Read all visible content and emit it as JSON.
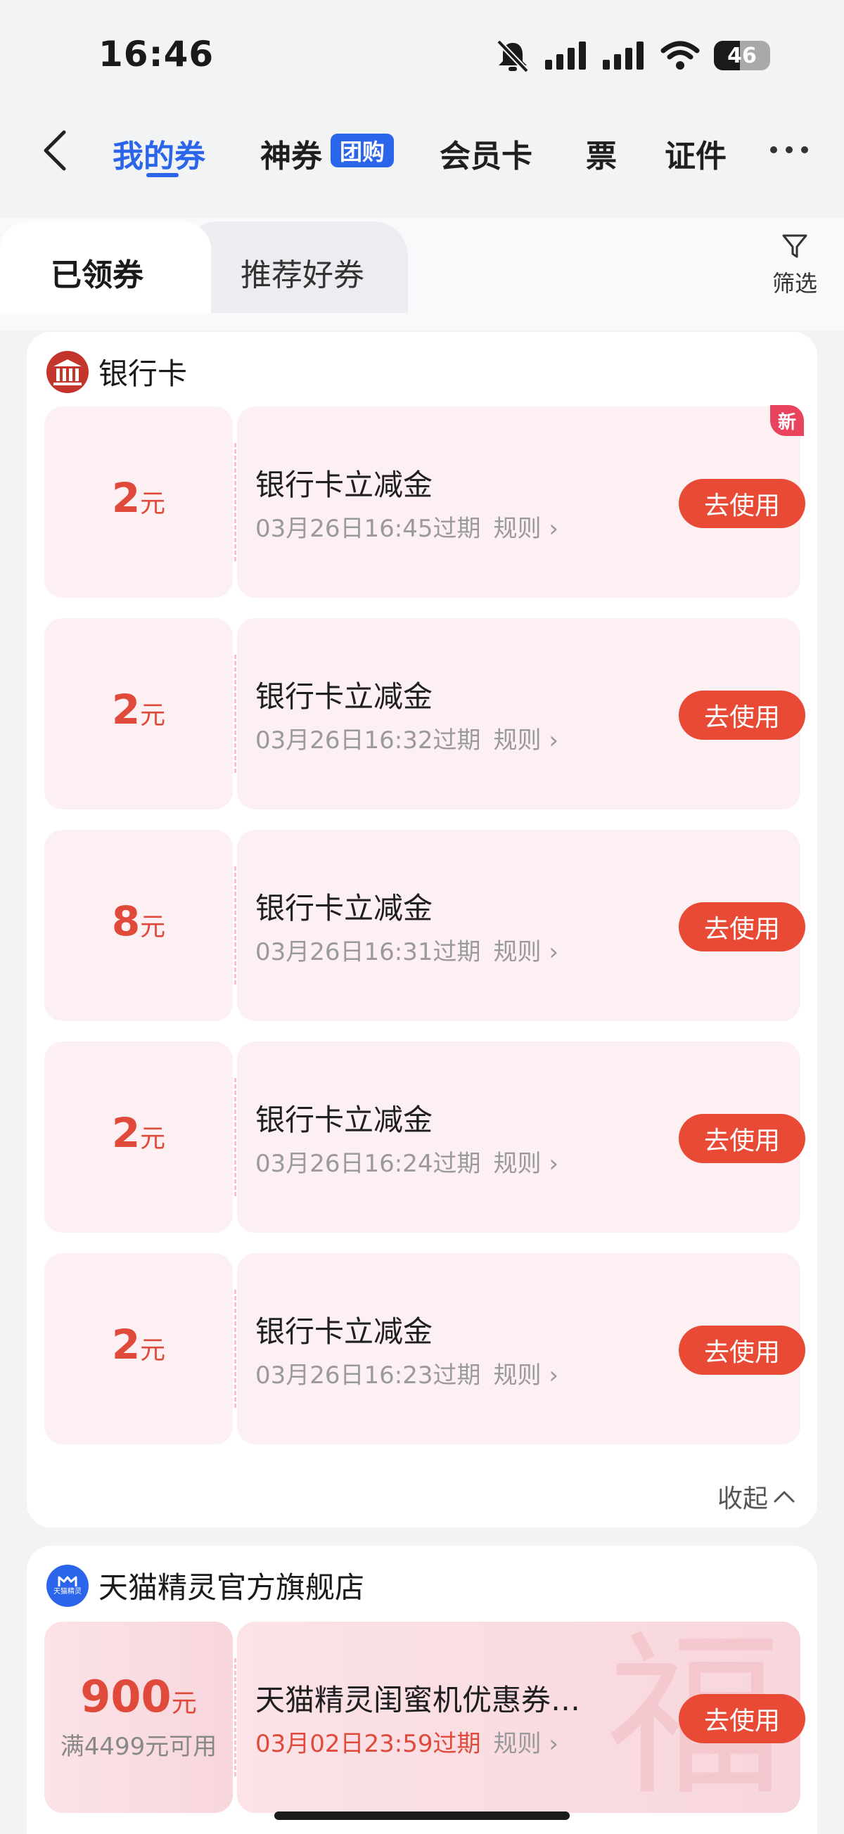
{
  "status_bar": {
    "time": "16:46",
    "battery_level": "46"
  },
  "nav": {
    "tabs": [
      {
        "label": "我的券"
      },
      {
        "label": "神券"
      },
      {
        "label": "会员卡"
      },
      {
        "label": "票"
      },
      {
        "label": "证件"
      }
    ],
    "tuan_badge": "团购"
  },
  "subtabs": {
    "received": "已领券",
    "recommended": "推荐好券",
    "filter": "筛选"
  },
  "bank_section": {
    "title": "银行卡",
    "collapse_label": "收起",
    "new_badge": "新",
    "coupons": [
      {
        "amount": "2",
        "unit": "元",
        "name": "银行卡立减金",
        "expiry": "03月26日16:45过期",
        "rule": "规则",
        "button": "去使用"
      },
      {
        "amount": "2",
        "unit": "元",
        "name": "银行卡立减金",
        "expiry": "03月26日16:32过期",
        "rule": "规则",
        "button": "去使用"
      },
      {
        "amount": "8",
        "unit": "元",
        "name": "银行卡立减金",
        "expiry": "03月26日16:31过期",
        "rule": "规则",
        "button": "去使用"
      },
      {
        "amount": "2",
        "unit": "元",
        "name": "银行卡立减金",
        "expiry": "03月26日16:24过期",
        "rule": "规则",
        "button": "去使用"
      },
      {
        "amount": "2",
        "unit": "元",
        "name": "银行卡立减金",
        "expiry": "03月26日16:23过期",
        "rule": "规则",
        "button": "去使用"
      }
    ]
  },
  "tmall_section": {
    "title": "天猫精灵官方旗舰店",
    "logo_text": "天猫精灵",
    "coupon": {
      "amount": "900",
      "unit": "元",
      "min": "满4499元可用",
      "name": "天猫精灵闺蜜机优惠券…",
      "expiry": "03月02日23:59过期",
      "rule": "规则",
      "button": "去使用"
    }
  },
  "colors": {
    "accent": "#2b66ea",
    "button_red": "#e94a36",
    "amount_red": "#e04a3b"
  }
}
